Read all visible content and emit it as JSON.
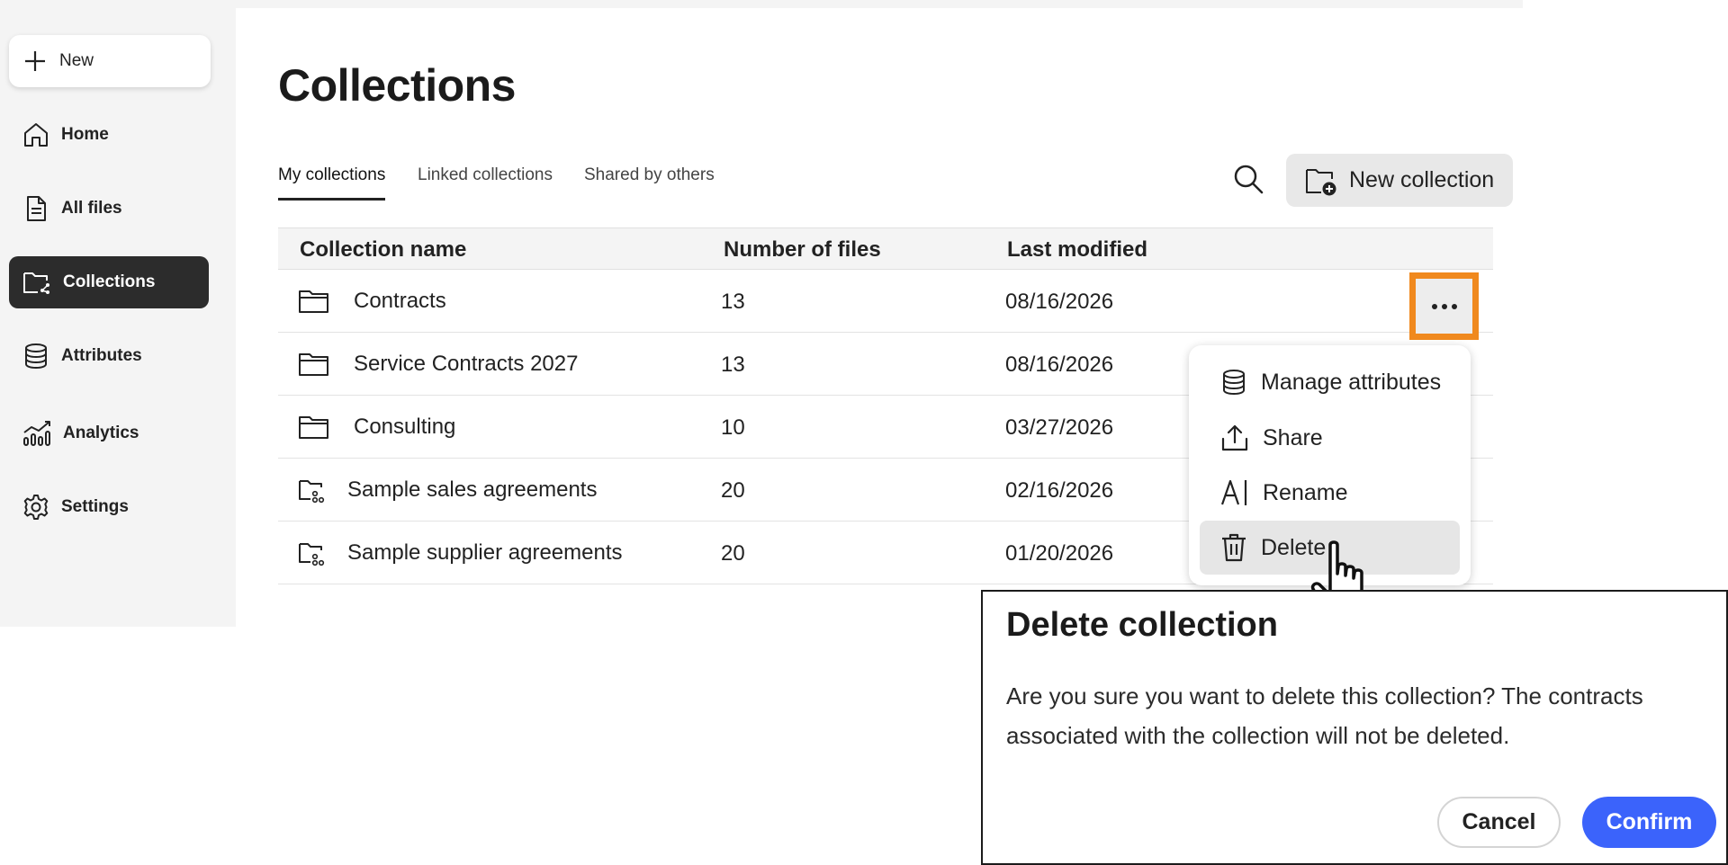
{
  "sidebar": {
    "new_label": "New",
    "items": [
      {
        "label": "Home",
        "icon": "home-icon"
      },
      {
        "label": "All files",
        "icon": "file-icon"
      },
      {
        "label": "Collections",
        "icon": "collections-icon",
        "active": true
      },
      {
        "label": "Attributes",
        "icon": "database-icon"
      },
      {
        "label": "Analytics",
        "icon": "analytics-icon"
      },
      {
        "label": "Settings",
        "icon": "gear-icon"
      }
    ]
  },
  "page": {
    "title": "Collections"
  },
  "tabs": [
    {
      "label": "My collections",
      "active": true
    },
    {
      "label": "Linked collections"
    },
    {
      "label": "Shared by others"
    }
  ],
  "toolbar": {
    "new_collection_label": "New collection"
  },
  "table": {
    "headers": [
      "Collection name",
      "Number of files",
      "Last modified"
    ],
    "rows": [
      {
        "name": "Contracts",
        "files": "13",
        "modified": "08/16/2026",
        "icon": "folder-icon"
      },
      {
        "name": "Service Contracts 2027",
        "files": "13",
        "modified": "08/16/2026",
        "icon": "folder-icon"
      },
      {
        "name": "Consulting",
        "files": "10",
        "modified": "03/27/2026",
        "icon": "folder-icon"
      },
      {
        "name": "Sample sales agreements",
        "files": "20",
        "modified": "02/16/2026",
        "icon": "shared-folder-icon"
      },
      {
        "name": "Sample supplier agreements",
        "files": "20",
        "modified": "01/20/2026",
        "icon": "shared-folder-icon"
      }
    ]
  },
  "context_menu": {
    "items": [
      {
        "label": "Manage attributes",
        "icon": "database-icon"
      },
      {
        "label": "Share",
        "icon": "share-icon"
      },
      {
        "label": "Rename",
        "icon": "rename-icon"
      },
      {
        "label": "Delete",
        "icon": "trash-icon",
        "hovered": true
      }
    ]
  },
  "dialog": {
    "title": "Delete collection",
    "body": "Are you sure you want to delete this collection? The contracts associated with the collection will not be deleted.",
    "cancel_label": "Cancel",
    "confirm_label": "Confirm"
  },
  "colors": {
    "accent": "#3b63fb",
    "highlight": "#f0891e",
    "active_nav": "#2c2c2c"
  }
}
